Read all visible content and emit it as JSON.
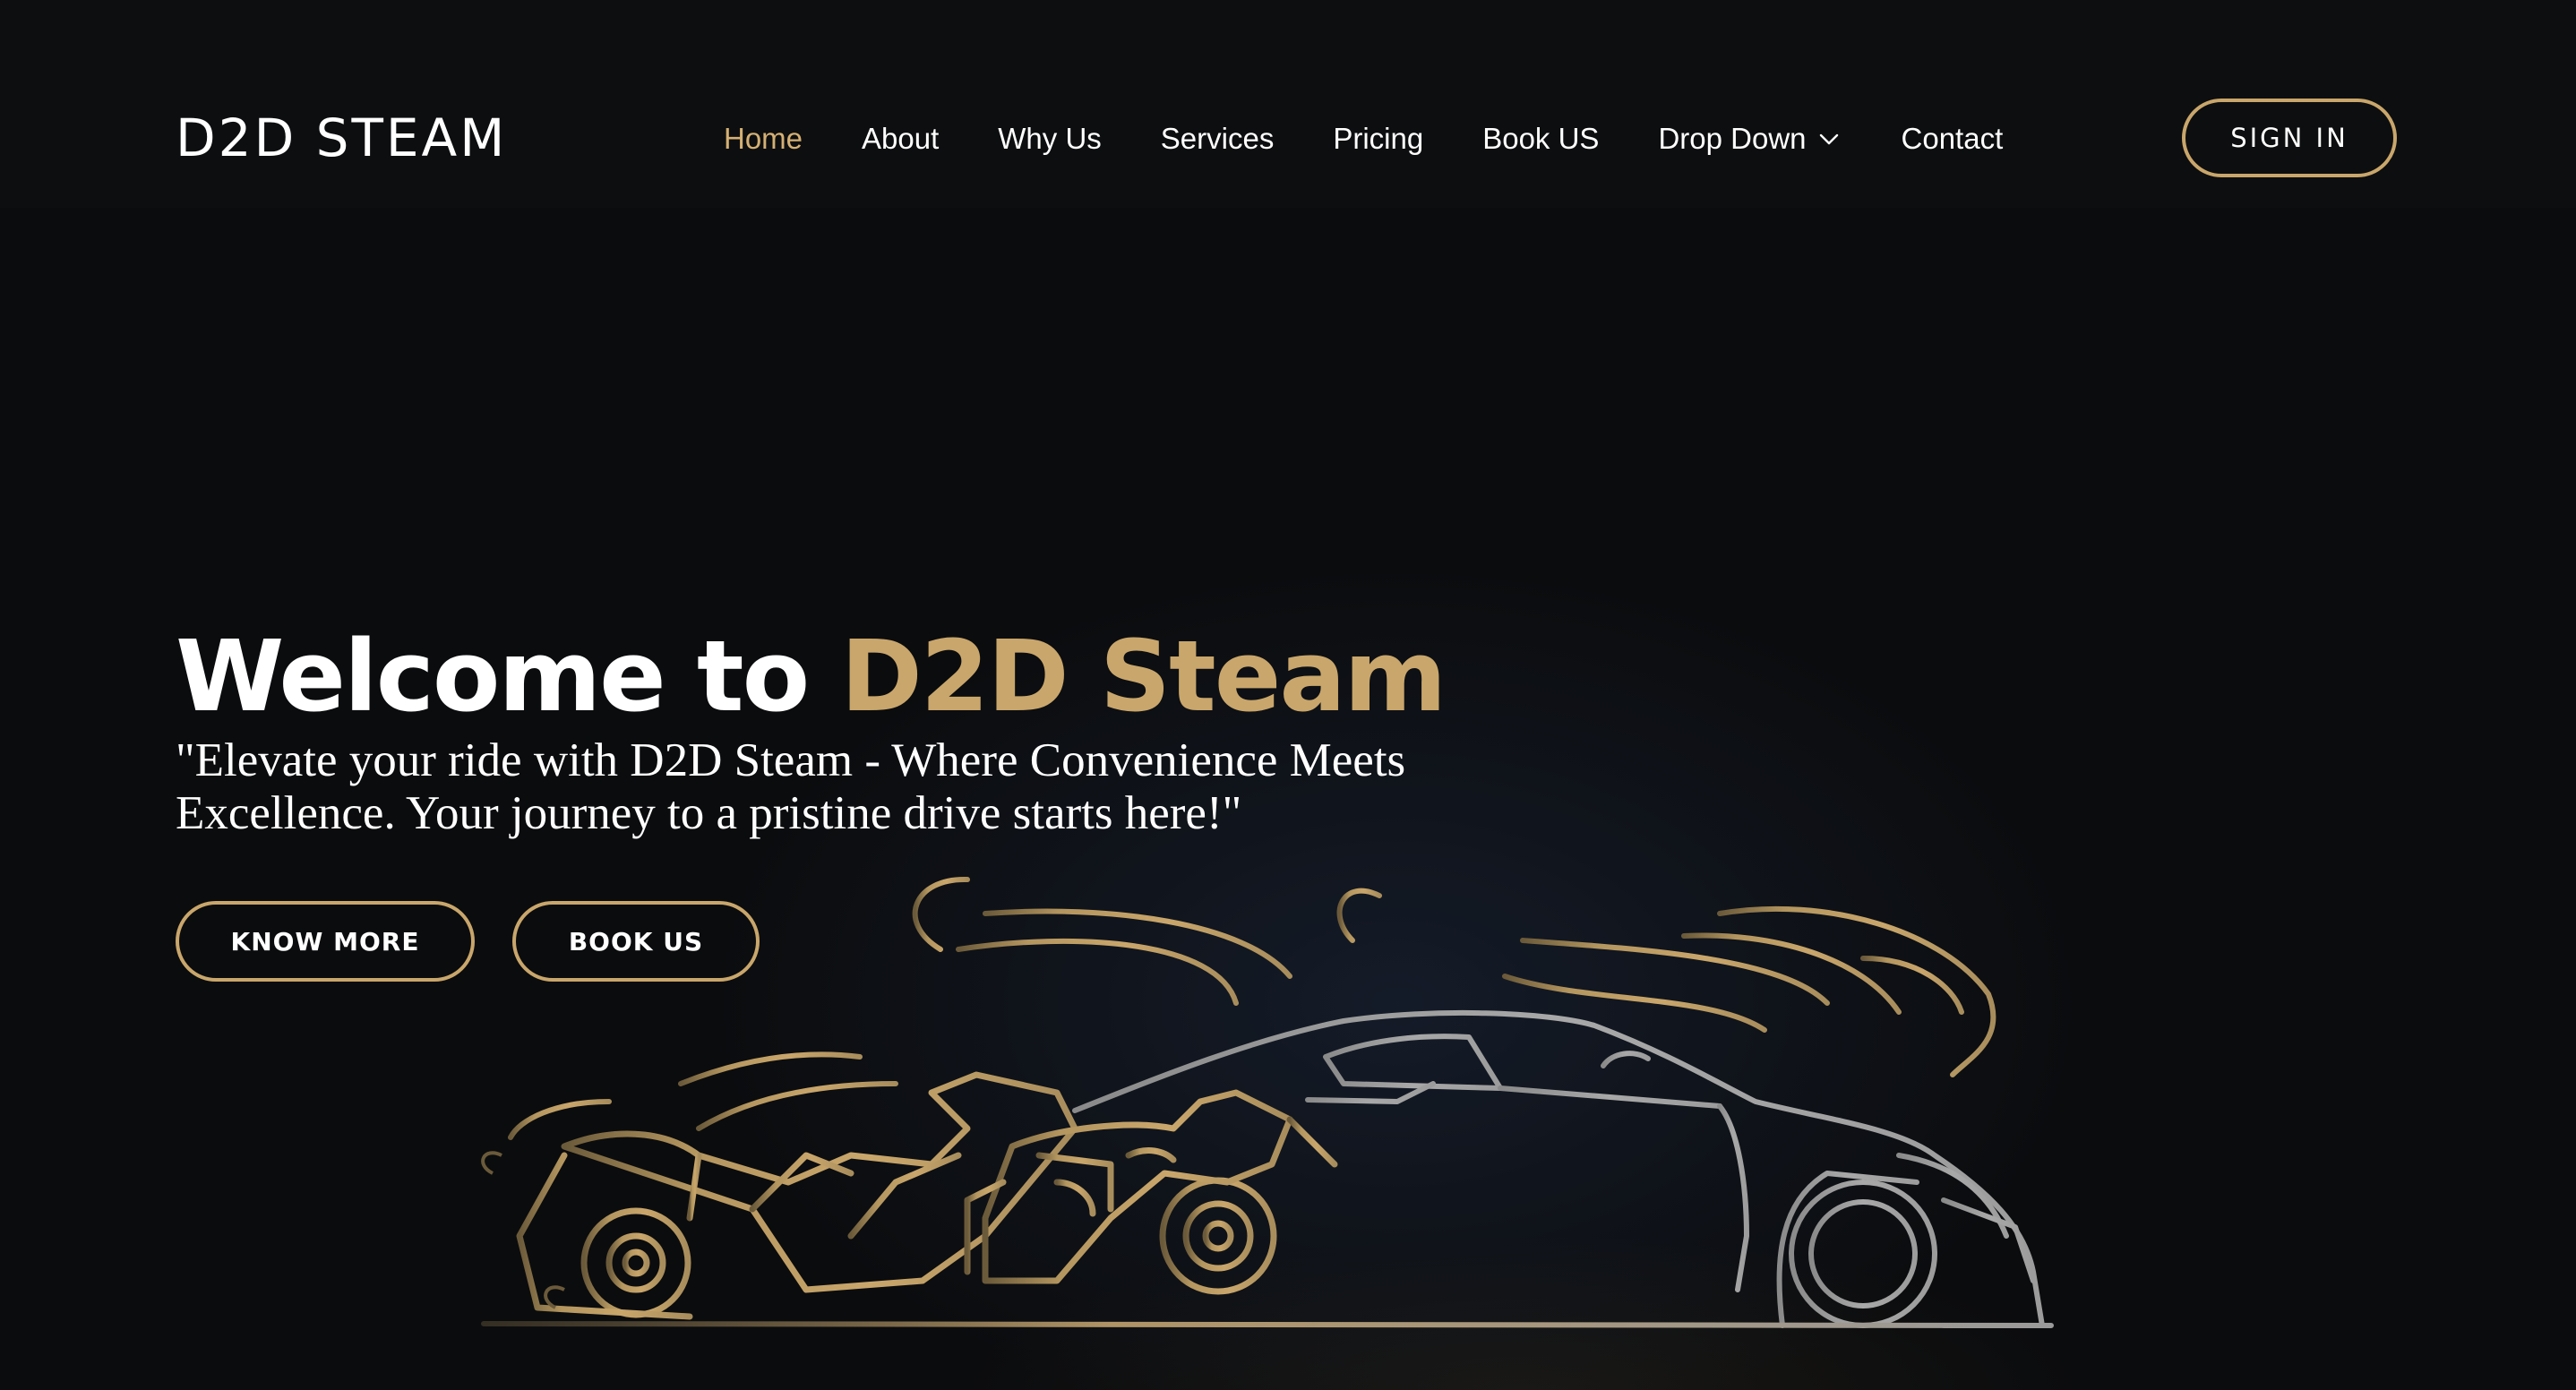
{
  "header": {
    "logo": "D2D STEAM",
    "nav": [
      {
        "label": "Home",
        "active": true
      },
      {
        "label": "About"
      },
      {
        "label": "Why Us"
      },
      {
        "label": "Services"
      },
      {
        "label": "Pricing"
      },
      {
        "label": "Book US"
      },
      {
        "label": "Drop Down",
        "has_dropdown": true,
        "icon": "chevron-down-icon"
      },
      {
        "label": "Contact"
      }
    ],
    "signin_label": "SIGN IN"
  },
  "hero": {
    "title_prefix": "Welcome to ",
    "title_highlight": "D2D Steam",
    "subtitle": "\"Elevate your ride with D2D Steam - Where Convenience Meets Excellence. Your journey to a pristine drive starts here!\"",
    "buttons": {
      "know_more": "KNOW MORE",
      "book_us": "BOOK US"
    },
    "illustration": "motorcycle-and-car-line-art"
  },
  "colors": {
    "accent": "#c9a66b",
    "active_nav": "#d4b074",
    "background": "#0b0c0e",
    "text": "#ffffff"
  }
}
